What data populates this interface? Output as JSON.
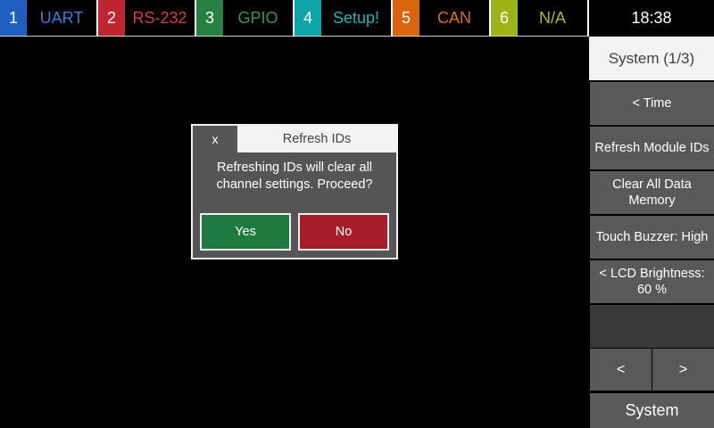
{
  "channels": [
    {
      "num": "1",
      "label": "UART",
      "num_bg": "#1f5fbf",
      "label_color": "#3b7be0"
    },
    {
      "num": "2",
      "label": "RS-232",
      "num_bg": "#c0242e",
      "label_color": "#d63c46"
    },
    {
      "num": "3",
      "label": "GPIO",
      "num_bg": "#27803f",
      "label_color": "#2f9a4a"
    },
    {
      "num": "4",
      "label": "Setup!",
      "num_bg": "#0fa5aa",
      "label_color": "#19b4b9"
    },
    {
      "num": "5",
      "label": "CAN",
      "num_bg": "#d9650c",
      "label_color": "#e06c14"
    },
    {
      "num": "6",
      "label": "N/A",
      "num_bg": "#9fb319",
      "label_color": "#a8bc1f"
    }
  ],
  "clock": "18:38",
  "menu": {
    "title": "System (1/3)",
    "items": [
      "<  Time",
      "Refresh Module IDs",
      "Clear All Data Memory",
      "Touch Buzzer: High",
      "< LCD Brightness: 60 %",
      ""
    ],
    "prev": "<",
    "next": ">",
    "footer": "System"
  },
  "dialog": {
    "close": "x",
    "title": "Refresh IDs",
    "message": "Refreshing IDs will clear all channel settings. Proceed?",
    "yes": "Yes",
    "no": "No"
  }
}
